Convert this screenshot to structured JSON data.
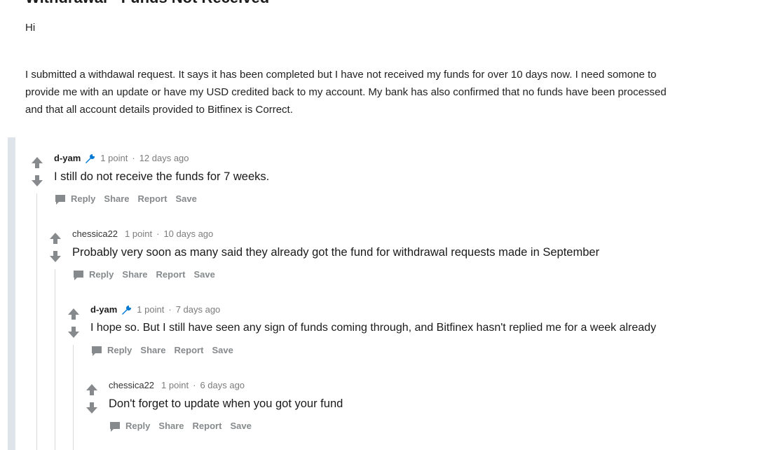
{
  "post": {
    "title": "Withdrawal - Funds Not Received",
    "greeting": "Hi",
    "body": "I submitted a withdawal request. It says it has been completed but I have not received my funds for over 10 days now. I need somone to provide me with an update or have my USD credited back to my account. My bank has also confirmed that no funds have been processed and that all account details provided to Bitfinex is Correct."
  },
  "icons": {
    "upvote": "arrow-up-icon",
    "downvote": "arrow-down-icon",
    "flair": "moderator-wrench-icon",
    "reply": "chat-bubble-icon"
  },
  "colors": {
    "arrow": "#878a8c",
    "flair": "#0079d3",
    "meta": "#7c7c7c",
    "thread_bar": "#dfe4ea"
  },
  "actions": {
    "reply": "Reply",
    "share": "Share",
    "report": "Report",
    "save": "Save"
  },
  "comments": [
    {
      "author": "d-yam",
      "points": "1 point",
      "separator": "·",
      "age": "12 days ago",
      "text": "I still do not receive the funds for 7 weeks."
    },
    {
      "author": "chessica22",
      "points": "1 point",
      "separator": "·",
      "age": "10 days ago",
      "text": "Probably very soon as many said they already got the fund for withdrawal requests made in September"
    },
    {
      "author": "d-yam",
      "points": "1 point",
      "separator": "·",
      "age": "7 days ago",
      "text": "I hope so. But I still have seen any sign of funds coming through, and Bitfinex hasn't replied me for a week already"
    },
    {
      "author": "chessica22",
      "points": "1 point",
      "separator": "·",
      "age": "6 days ago",
      "text": "Don't forget to update when you got your fund"
    }
  ]
}
